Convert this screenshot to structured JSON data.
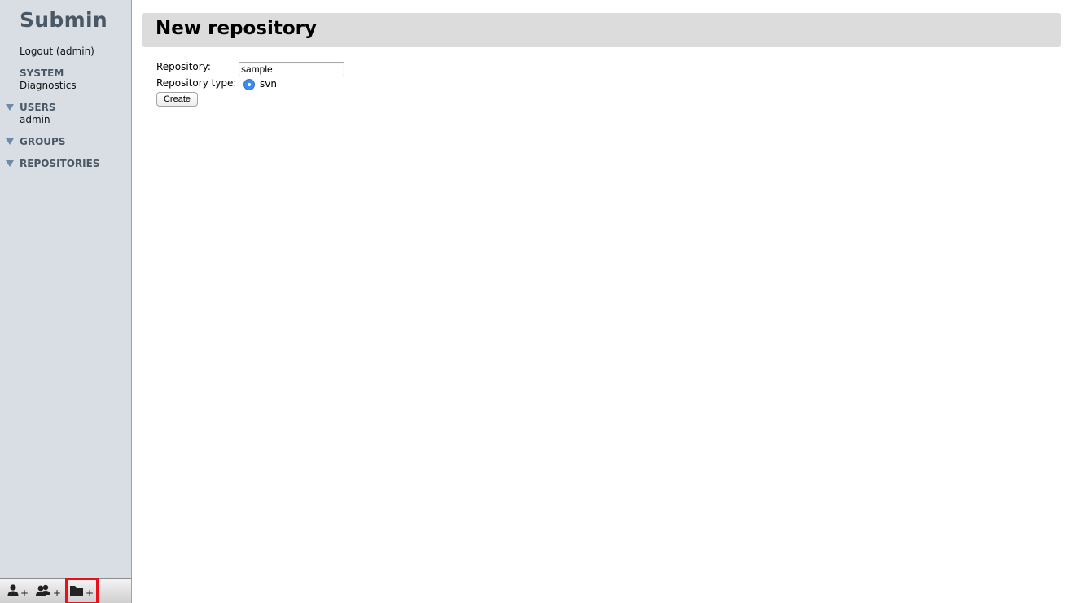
{
  "app": {
    "title": "Submin"
  },
  "sidebar": {
    "logout_label": "Logout (admin)",
    "system": {
      "label": "SYSTEM",
      "items": [
        "Diagnostics"
      ]
    },
    "users": {
      "label": "USERS",
      "expanded": true,
      "items": [
        "admin"
      ]
    },
    "groups": {
      "label": "GROUPS",
      "expanded": true,
      "items": []
    },
    "repositories": {
      "label": "REPOSITORIES",
      "expanded": true,
      "items": []
    }
  },
  "toolbar": {
    "buttons": [
      {
        "icon": "add-user-icon",
        "selected": false
      },
      {
        "icon": "add-group-icon",
        "selected": false
      },
      {
        "icon": "add-repository-icon",
        "selected": true
      }
    ],
    "plus": "+"
  },
  "main": {
    "title": "New repository",
    "form": {
      "repository_label": "Repository:",
      "repository_value": "sample",
      "type_label": "Repository type:",
      "type_options": [
        {
          "label": "svn",
          "selected": true
        }
      ],
      "create_label": "Create"
    }
  },
  "colors": {
    "sidebar_bg": "#d9dee5",
    "section_label": "#4a5866",
    "header_bg": "#dcdcdc",
    "radio_selected": "#3b8ef0",
    "highlight": "#e8101a"
  }
}
